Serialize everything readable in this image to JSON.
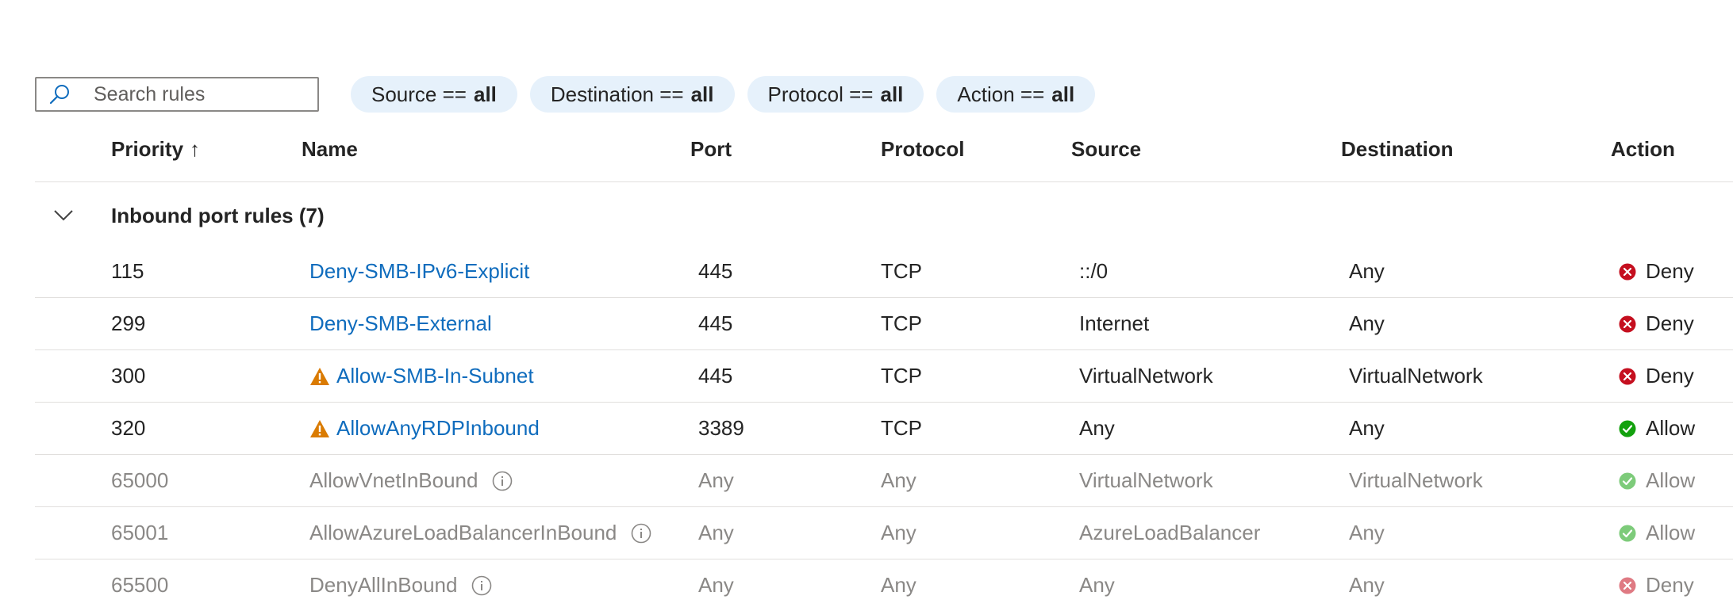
{
  "search": {
    "placeholder": "Search rules",
    "value": ""
  },
  "filters": [
    {
      "key": "Source ==",
      "value": "all"
    },
    {
      "key": "Destination ==",
      "value": "all"
    },
    {
      "key": "Protocol ==",
      "value": "all"
    },
    {
      "key": "Action ==",
      "value": "all"
    }
  ],
  "columns": {
    "priority": "Priority",
    "priority_sort": "↑",
    "name": "Name",
    "port": "Port",
    "protocol": "Protocol",
    "source": "Source",
    "destination": "Destination",
    "action": "Action"
  },
  "group": {
    "label": "Inbound port rules (7)"
  },
  "colors": {
    "link": "#0f6cbd",
    "deny": "#c50f1f",
    "allow": "#13a10e",
    "warning": "#da7b02",
    "pill": "#e6f1fb"
  },
  "rows": [
    {
      "priority": "115",
      "name": "Deny-SMB-IPv6-Explicit",
      "port": "445",
      "protocol": "TCP",
      "source": "::/0",
      "destination": "Any",
      "action": "Deny"
    },
    {
      "priority": "299",
      "name": "Deny-SMB-External",
      "port": "445",
      "protocol": "TCP",
      "source": "Internet",
      "destination": "Any",
      "action": "Deny"
    },
    {
      "priority": "300",
      "name": "Allow-SMB-In-Subnet",
      "port": "445",
      "protocol": "TCP",
      "source": "VirtualNetwork",
      "destination": "VirtualNetwork",
      "action": "Deny"
    },
    {
      "priority": "320",
      "name": "AllowAnyRDPInbound",
      "port": "3389",
      "protocol": "TCP",
      "source": "Any",
      "destination": "Any",
      "action": "Allow"
    },
    {
      "priority": "65000",
      "name": "AllowVnetInBound",
      "port": "Any",
      "protocol": "Any",
      "source": "VirtualNetwork",
      "destination": "VirtualNetwork",
      "action": "Allow"
    },
    {
      "priority": "65001",
      "name": "AllowAzureLoadBalancerInBound",
      "port": "Any",
      "protocol": "Any",
      "source": "AzureLoadBalancer",
      "destination": "Any",
      "action": "Allow"
    },
    {
      "priority": "65500",
      "name": "DenyAllInBound",
      "port": "Any",
      "protocol": "Any",
      "source": "Any",
      "destination": "Any",
      "action": "Deny"
    }
  ]
}
